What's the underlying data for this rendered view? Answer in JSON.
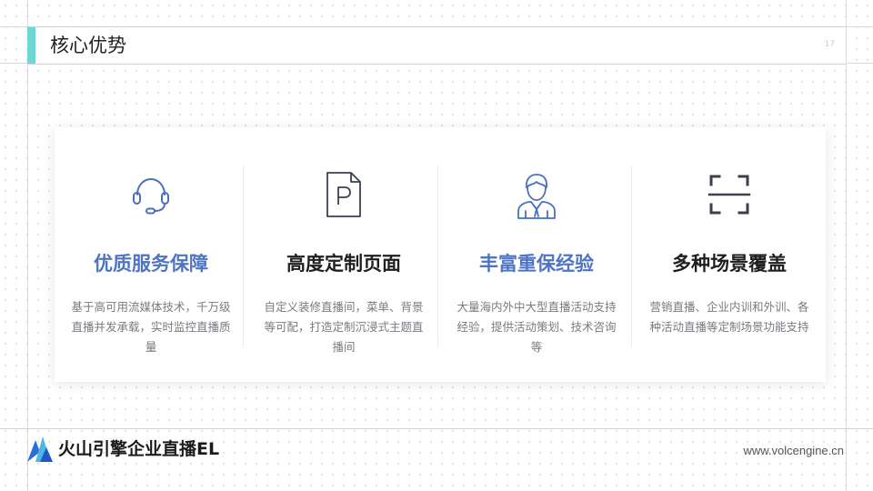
{
  "header": {
    "title": "核心优势",
    "page_number": "17"
  },
  "features": [
    {
      "icon": "headset-icon",
      "heading": "优质服务保障",
      "body": "基于高可用流媒体技术，千万级直播并发承载，实时监控直播质量",
      "highlight": true
    },
    {
      "icon": "page-p-icon",
      "heading": "高度定制页面",
      "body": "自定义装修直播间，菜单、背景等可配，打造定制沉浸式主题直播间",
      "highlight": false
    },
    {
      "icon": "consultant-icon",
      "heading": "丰富重保经验",
      "body": "大量海内外中大型直播活动支持经验，提供活动策划、技术咨询等",
      "highlight": true
    },
    {
      "icon": "scan-frame-icon",
      "heading": "多种场景覆盖",
      "body": "营销直播、企业内训和外训、各种活动直播等定制场景功能支持",
      "highlight": false
    }
  ],
  "footer": {
    "brand": "火山引擎企业直播EL",
    "website": "www.volcengine.cn"
  },
  "colors": {
    "accent_teal": "#6fd6d4",
    "highlight_blue": "#4f74c4",
    "heading_dark": "#1f1f1f",
    "icon_blue": "#4a6fbf",
    "icon_gray": "#3c4150"
  }
}
